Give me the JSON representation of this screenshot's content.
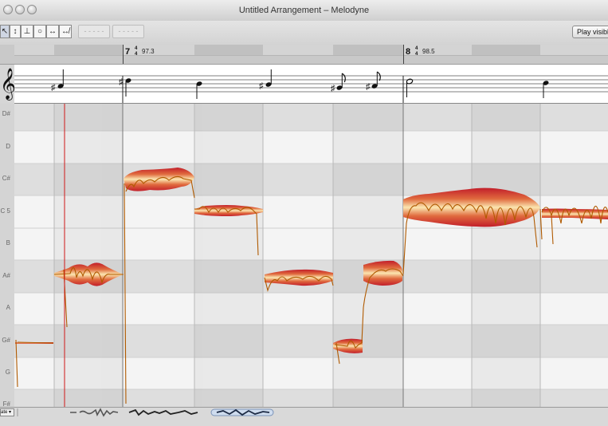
{
  "window": {
    "title": "Untitled Arrangement – Melodyne"
  },
  "toolbar": {
    "tools": [
      {
        "name": "main-tool-icon",
        "glyph": "↖"
      },
      {
        "name": "pitch-tool-icon",
        "glyph": "↕"
      },
      {
        "name": "pitch-modulation-tool-icon",
        "glyph": "⊥"
      },
      {
        "name": "formant-tool-icon",
        "glyph": "○"
      },
      {
        "name": "time-tool-icon",
        "glyph": "↔"
      },
      {
        "name": "note-separation-tool-icon",
        "glyph": "↮"
      }
    ],
    "ghost_buttons": [
      "- - - - -",
      "- - - - -"
    ],
    "play_visible_label": "Play visible"
  },
  "ruler": {
    "bars": [
      {
        "number": "7",
        "ts_top": "4",
        "ts_bottom": "4",
        "tempo": "97.3"
      },
      {
        "number": "8",
        "ts_top": "4",
        "ts_bottom": "4",
        "tempo": "98.5"
      }
    ]
  },
  "score": {
    "clef": "treble-clef",
    "notes": [
      {
        "type": "quarter",
        "accidental": "♯"
      },
      {
        "type": "quarter",
        "accidental": "♯"
      },
      {
        "type": "quarter",
        "accidental": ""
      },
      {
        "type": "quarter",
        "accidental": "♯"
      },
      {
        "type": "eighth",
        "accidental": "♯"
      },
      {
        "type": "eighth",
        "accidental": "♯"
      },
      {
        "type": "half",
        "accidental": ""
      },
      {
        "type": "quarter",
        "accidental": ""
      }
    ]
  },
  "pitch_lanes": [
    "D#",
    "D",
    "C#",
    "C 5",
    "B",
    "A#",
    "A",
    "G#",
    "G",
    "F#"
  ],
  "blobs": [
    {
      "pitch": "G#",
      "beat_start": 0.0,
      "beat_end": 0.6
    },
    {
      "pitch": "A#",
      "beat_start": 0.6,
      "beat_end": 1.6
    },
    {
      "pitch": "C#",
      "beat_start": 1.6,
      "beat_end": 2.6
    },
    {
      "pitch": "C 5",
      "beat_start": 2.6,
      "beat_end": 3.6
    },
    {
      "pitch": "A#",
      "beat_start": 3.6,
      "beat_end": 4.6
    },
    {
      "pitch": "G#",
      "beat_start": 4.6,
      "beat_end": 5.0
    },
    {
      "pitch": "A#",
      "beat_start": 5.0,
      "beat_end": 5.6
    },
    {
      "pitch": "C 5",
      "beat_start": 5.6,
      "beat_end": 7.7
    },
    {
      "pitch": "C 5",
      "beat_start": 7.7,
      "beat_end": 8.6
    }
  ],
  "bottom": {
    "zoom_label": "ate ▾"
  },
  "colors": {
    "accent": "#3a6fd8",
    "blob_dark": "#c21e2a",
    "blob_mid": "#e06a3e",
    "blob_light": "#fbe6b0",
    "pitch_curve": "#b05a00",
    "playhead": "#d01818"
  }
}
